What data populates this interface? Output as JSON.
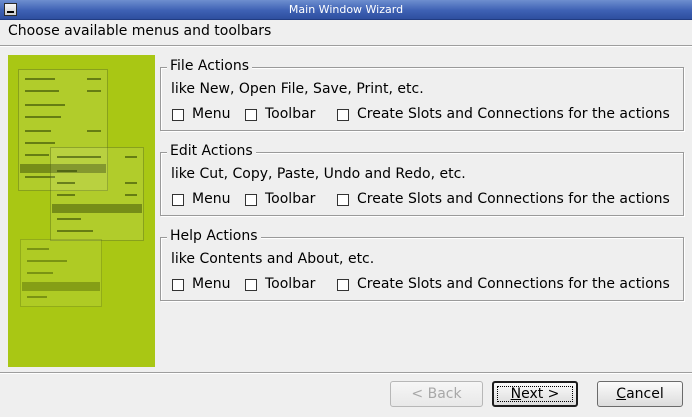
{
  "window": {
    "title": "Main Window Wizard"
  },
  "heading": "Choose available menus and toolbars",
  "groups": [
    {
      "title": "File Actions",
      "description": "like New, Open File, Save, Print, etc.",
      "options": {
        "menu": "Menu",
        "toolbar": "Toolbar",
        "slots": "Create Slots and Connections for the actions"
      }
    },
    {
      "title": "Edit Actions",
      "description": "like Cut, Copy, Paste, Undo and Redo, etc.",
      "options": {
        "menu": "Menu",
        "toolbar": "Toolbar",
        "slots": "Create Slots and Connections for the actions"
      }
    },
    {
      "title": "Help Actions",
      "description": "like Contents and About, etc.",
      "options": {
        "menu": "Menu",
        "toolbar": "Toolbar",
        "slots": "Create Slots and Connections for the actions"
      }
    }
  ],
  "buttons": {
    "back": {
      "mnemonic": "",
      "rest": "< Back",
      "enabled": false
    },
    "next": {
      "mnemonic": "N",
      "rest": "ext >",
      "enabled": true
    },
    "cancel": {
      "mnemonic": "C",
      "rest": "ancel",
      "enabled": true
    }
  },
  "icons": {
    "window_menu": "window-menu-icon",
    "checkbox": "checkbox-icon"
  },
  "colors": {
    "titlebar": "#3e61b4",
    "illustration": "#a9c714",
    "background": "#efefef"
  }
}
